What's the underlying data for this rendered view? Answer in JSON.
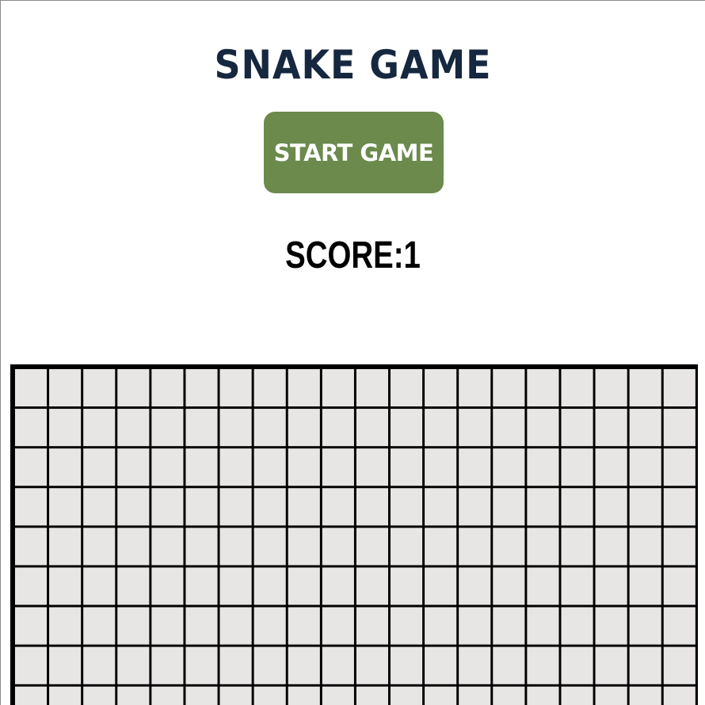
{
  "game": {
    "title": "SNAKE GAME",
    "start_button_label": "START GAME",
    "score_text": "SCORE:1"
  },
  "colors": {
    "title": "#16283f",
    "start_button_bg": "#6b8a4c",
    "start_button_text": "#ffffff",
    "board_cell": "#e8e5e5",
    "grid_line": "#000000"
  }
}
